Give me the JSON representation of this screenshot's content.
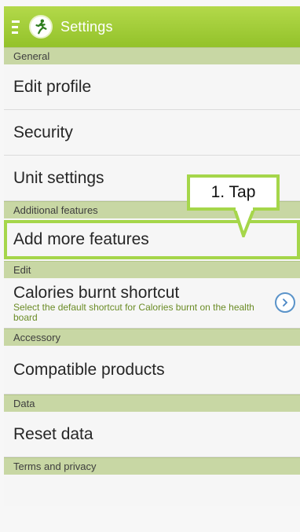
{
  "action_bar": {
    "title": "Settings",
    "menu_icon": "drawer-menu-icon",
    "app_icon": "running-person-icon",
    "color": "#9fcc35"
  },
  "sections": [
    {
      "header": "General",
      "items": [
        "Edit profile",
        "Security",
        "Unit settings"
      ]
    },
    {
      "header": "Additional features",
      "items": [
        "Add more features"
      ]
    },
    {
      "header": "Edit",
      "items": []
    },
    {
      "header": "Accessory",
      "items": [
        "Compatible products"
      ]
    },
    {
      "header": "Data",
      "items": [
        "Reset data"
      ]
    },
    {
      "header": "Terms and privacy",
      "items": []
    }
  ],
  "calories_item": {
    "title": "Calories burnt shortcut",
    "subtitle": "Select the default shortcut for Calories burnt on the health board",
    "icon": "chevron-right-icon"
  },
  "callout": {
    "text": "1. Tap",
    "color": "#a5d64a"
  }
}
